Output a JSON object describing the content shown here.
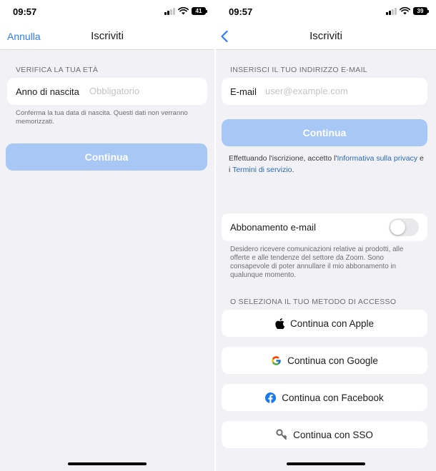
{
  "left": {
    "status": {
      "time": "09:57",
      "battery": "41"
    },
    "nav": {
      "cancel": "Annulla",
      "title": "Iscriviti"
    },
    "section_label": "VERIFICA LA TUA ETÀ",
    "birth_field": {
      "label": "Anno di nascita",
      "placeholder": "Obbligatorio",
      "value": ""
    },
    "note": "Conferma la tua data di nascita. Questi dati non verranno memorizzati.",
    "continue": "Continua"
  },
  "right": {
    "status": {
      "time": "09:57",
      "battery": "39"
    },
    "nav": {
      "title": "Iscriviti",
      "back_icon": "chevron-left-icon"
    },
    "section_label": "INSERISCI IL TUO INDIRIZZO E-MAIL",
    "email_field": {
      "label": "E-mail",
      "placeholder": "user@example.com",
      "value": ""
    },
    "continue": "Continua",
    "legal": {
      "prefix": "Effettuando l'iscrizione, accetto l'",
      "privacy_link": "Informativa sulla privacy",
      "middle": " e i ",
      "terms_link": "Termini di servizio",
      "suffix": "."
    },
    "subscription": {
      "label": "Abbonamento e-mail",
      "enabled": false,
      "note": "Desidero ricevere comunicazioni relative ai prodotti, alle offerte e alle tendenze del settore da Zoom. Sono consapevole di poter annullare il mio abbonamento in qualunque momento."
    },
    "access_label": "O SELEZIONA IL TUO METODO DI ACCESSO",
    "social": [
      {
        "label": "Continua con Apple",
        "icon": "apple-icon"
      },
      {
        "label": "Continua con Google",
        "icon": "google-icon"
      },
      {
        "label": "Continua con Facebook",
        "icon": "facebook-icon"
      },
      {
        "label": "Continua con SSO",
        "icon": "key-icon"
      }
    ]
  },
  "colors": {
    "accent": "#2f7cf6",
    "button_disabled": "#a7c8f4",
    "background": "#f2f2f6",
    "link": "#2968b8"
  }
}
